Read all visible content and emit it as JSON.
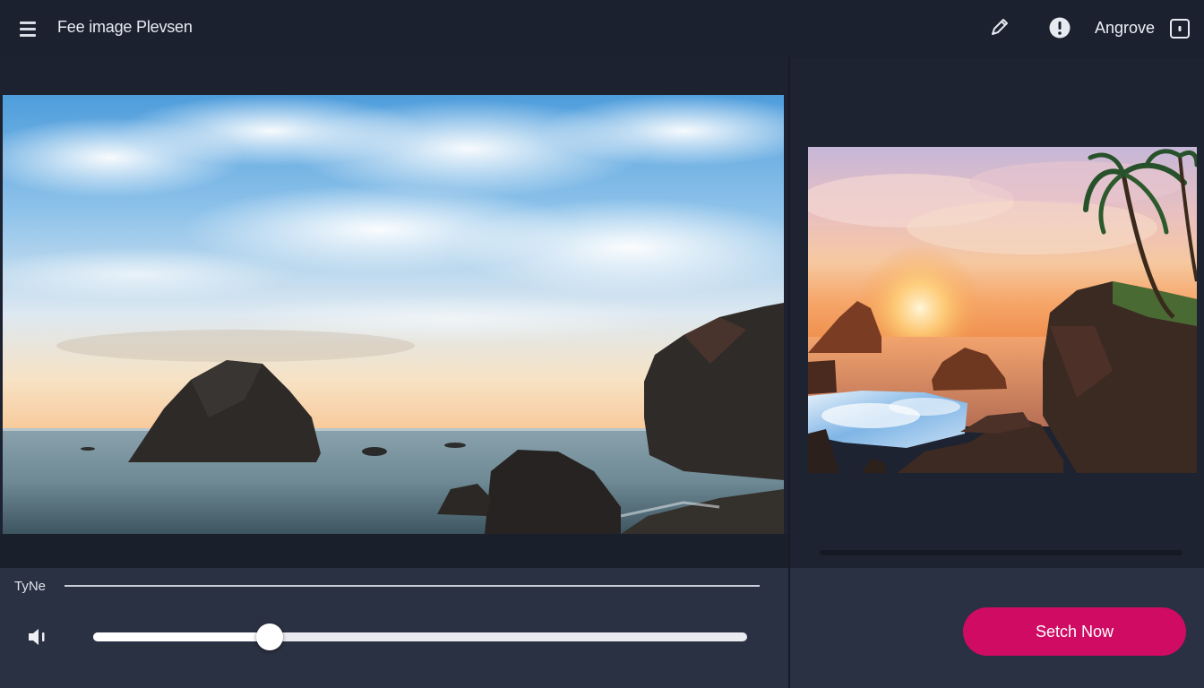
{
  "header": {
    "title": "Fee image Plevsen",
    "user_name": "Angrove",
    "icons": [
      "menu-icon",
      "pen-icon",
      "alert-icon",
      "user-badge-icon"
    ]
  },
  "controls": {
    "type_label": "TyNe",
    "volume_icon": "volume-icon",
    "slider_value": 0.27
  },
  "actions": {
    "primary_label": "Setch Now"
  },
  "colors": {
    "accent": "#cf0b63",
    "background": "#1d2230",
    "controls_bg": "#2a3142"
  }
}
